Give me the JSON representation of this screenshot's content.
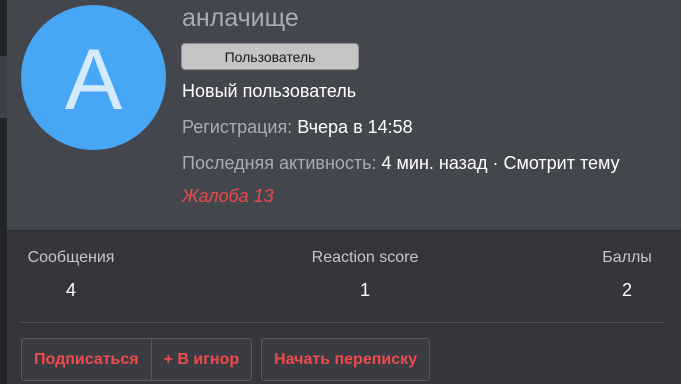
{
  "profile": {
    "avatar_letter": "A",
    "avatar_color": "#47a7f5",
    "username": "анлачище",
    "role_badge": "Пользователь",
    "user_title": "Новый пользователь",
    "registration_label": "Регистрация:",
    "registration_value": "Вчера в 14:58",
    "last_activity_label": "Последняя активность:",
    "last_activity_value": "4 мин. назад · Смотрит тему",
    "report_link": "Жалоба 13"
  },
  "stats": {
    "messages": {
      "label": "Сообщения",
      "value": "4"
    },
    "reaction_score": {
      "label": "Reaction score",
      "value": "1"
    },
    "points": {
      "label": "Баллы",
      "value": "2"
    }
  },
  "actions": {
    "follow": "Подписаться",
    "ignore": "+ В игнор",
    "start_conversation": "Начать переписку"
  },
  "colors": {
    "accent": "#ee4b4b",
    "card_header_bg": "#44464d",
    "card_bg": "#34363b"
  }
}
